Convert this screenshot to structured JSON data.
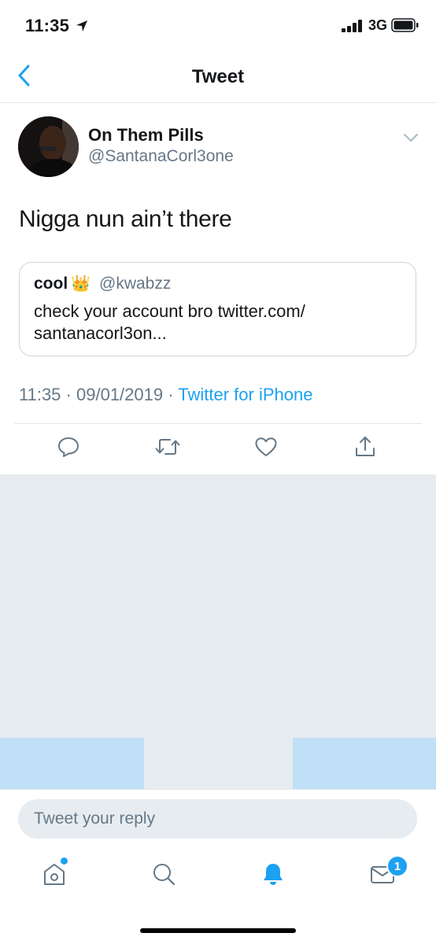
{
  "status_bar": {
    "time": "11:35",
    "network": "3G"
  },
  "nav": {
    "title": "Tweet"
  },
  "tweet": {
    "author_name": "On Them Pills",
    "author_handle": "@SantanaCorl3one",
    "text": "Nigga nun ain’t there",
    "quote": {
      "name": "cool",
      "crown": "👑",
      "handle": "@kwabzz",
      "text": "check your account bro twitter.com/\nsantanacorl3on..."
    },
    "meta": {
      "time": "11:35",
      "date": "09/01/2019",
      "separator": "·",
      "source": "Twitter for iPhone"
    }
  },
  "reply": {
    "placeholder": "Tweet your reply"
  },
  "tabbar": {
    "messages_badge": "1"
  },
  "colors": {
    "accent": "#1da1f2",
    "secondary_text": "#657786",
    "gray_bg": "#e6ecf0",
    "light_blue": "#bfe0f7"
  }
}
